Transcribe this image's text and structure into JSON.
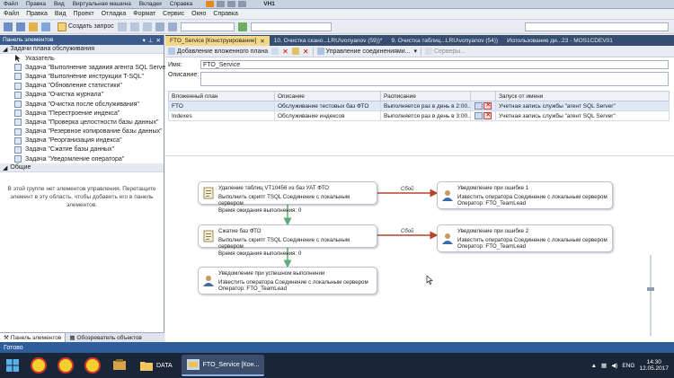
{
  "vm_menu": {
    "items": [
      "Файл",
      "Правка",
      "Вид",
      "Виртуальная машина",
      "Вкладки",
      "Справка"
    ],
    "vm_name": "VH1"
  },
  "ssms_menu": {
    "items": [
      "Файл",
      "Правка",
      "Вид",
      "Проект",
      "Отладка",
      "Формат",
      "Сервис",
      "Окно",
      "Справка"
    ]
  },
  "toolbar": {
    "new_query_label": "Создать запрос"
  },
  "left_panel": {
    "title": "Панель элементов",
    "group_maintenance": "Задачи плана обслуживания",
    "items": [
      "Указатель",
      "Задача \"Выполнение задания агента SQL Server\"",
      "Задача \"Выполнение инструкции T-SQL\"",
      "Задача \"Обновление статистики\"",
      "Задача \"Очистка журнала\"",
      "Задача \"Очистка после обслуживания\"",
      "Задача \"Перестроение индекса\"",
      "Задача \"Проверка целостности базы данных\"",
      "Задача \"Резервное копирование базы данных\"",
      "Задача \"Реорганизация индекса\"",
      "Задача \"Сжатие базы данных\"",
      "Задача \"Уведомление оператора\""
    ],
    "group_general": "Общие",
    "general_text": "В этой группе нет элементов управления. Перетащите элемент в эту область, чтобы добавить его в панель элементов.",
    "tab_toolbox": "Панель элементов",
    "tab_explorer": "Обозреватель объектов"
  },
  "doc_tabs": [
    "FTO_Service [Конструирование]",
    "10. Очистка скано...LRU\\vonyanov (59))*",
    "9. Очистка таблиц...LRU\\vonyanov (54))",
    "Использование ди...23 - MOS1CDEV01"
  ],
  "designer_toolbar": {
    "add_subplan": "Добавление вложенного плана",
    "manage_connections": "Управление соединениями...",
    "servers": "Серверы..."
  },
  "plan_form": {
    "name_label": "Имя:",
    "name_value": "FTO_Service",
    "description_label": "Описание:"
  },
  "subplans": {
    "headers": [
      "Вложенный план",
      "Описание",
      "Расписание",
      "Запуск от имени"
    ],
    "rows": [
      [
        "FTO",
        "Обслуживание тестовых баз ФТО",
        "Выполняется раз в день в 2:00...",
        "Учетная запись службы \"агент SQL Server\""
      ],
      [
        "Indexes",
        "Обслуживание индексов",
        "Выполняется раз в день в 3:00...",
        "Учетная запись службы \"агент SQL Server\""
      ]
    ]
  },
  "tasks": {
    "truncate": {
      "title": "Удаление таблиц VT10456 из баз УАТ ФТО",
      "line1": "Выполнить скрипт TSQL Соединение с локальным сервером",
      "line2": "Время ожидания выполнения: 0"
    },
    "shrink": {
      "title": "Сжатие баз ФТО",
      "line1": "Выполнить скрипт TSQL Соединение с локальным сервером",
      "line2": "Время ожидания выполнения: 0"
    },
    "notify_success": {
      "title": "Уведомление при успешном выполнении",
      "line1": "Известить оператора Соединение с локальным сервером",
      "line2": "Оператор: FTO_TeamLead"
    },
    "notify_error1": {
      "title": "Уведомление при ошибке 1",
      "line1": "Известить оператора Соединение с локальным сервером",
      "line2": "Оператор: FTO_TeamLead"
    },
    "notify_error2": {
      "title": "Уведомление при ошибке 2",
      "line1": "Известить оператора Соединение с локальным сервером",
      "line2": "Оператор: FTO_TeamLead"
    },
    "fail_label": "Сбой"
  },
  "status_text": "Готово",
  "taskbar": {
    "folder_label": "DATA",
    "ssms_label": "FTO_Service [Кон...",
    "lang": "ENG",
    "time": "14:30",
    "date": "12.05.2017"
  },
  "colors": {
    "success": "#5dab77",
    "failure": "#b5452a",
    "accent": "#2f5c9a"
  }
}
